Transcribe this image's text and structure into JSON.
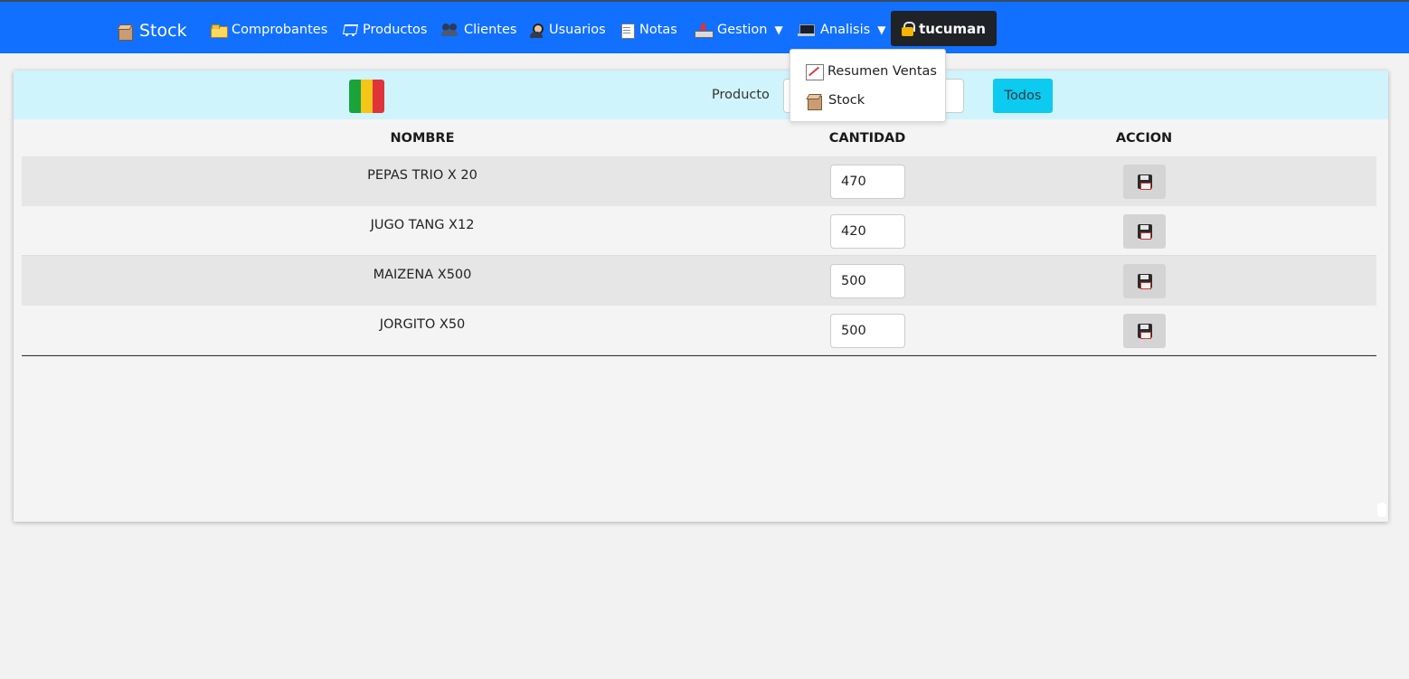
{
  "navbar": {
    "brand": "Stock",
    "items": [
      {
        "label": "Comprobantes",
        "icon": "folder-icon"
      },
      {
        "label": "Productos",
        "icon": "cart-icon"
      },
      {
        "label": "Clientes",
        "icon": "users-icon"
      },
      {
        "label": "Usuarios",
        "icon": "user-icon"
      },
      {
        "label": "Notas",
        "icon": "note-icon"
      },
      {
        "label": "Gestion",
        "icon": "inbox-icon",
        "caret": "▼"
      },
      {
        "label": "Analisis",
        "icon": "laptop-icon",
        "caret": "▼"
      }
    ],
    "user": "tucuman",
    "colors": {
      "bar": "#1170ff",
      "user_pill": "#1f2226"
    }
  },
  "dropdown": {
    "items": [
      {
        "label": "Resumen Ventas",
        "icon": "chart-icon"
      },
      {
        "label": "Stock",
        "icon": "box-icon"
      }
    ]
  },
  "filter": {
    "flag_colors": [
      "#1aa33a",
      "#f5c518",
      "#e0333a"
    ],
    "product_label": "Producto",
    "product_value": "",
    "todos_label": "Todos",
    "colors": {
      "toolbar_bg": "#cff4fc",
      "todos_bg": "#0dcaf0"
    }
  },
  "table": {
    "headers": {
      "name": "NOMBRE",
      "qty": "CANTIDAD",
      "action": "ACCION"
    },
    "rows": [
      {
        "name": "PEPAS TRIO X 20",
        "qty": "470"
      },
      {
        "name": "JUGO TANG X12",
        "qty": "420"
      },
      {
        "name": "MAIZENA X500",
        "qty": "500"
      },
      {
        "name": "JORGITO X50",
        "qty": "500"
      }
    ]
  }
}
